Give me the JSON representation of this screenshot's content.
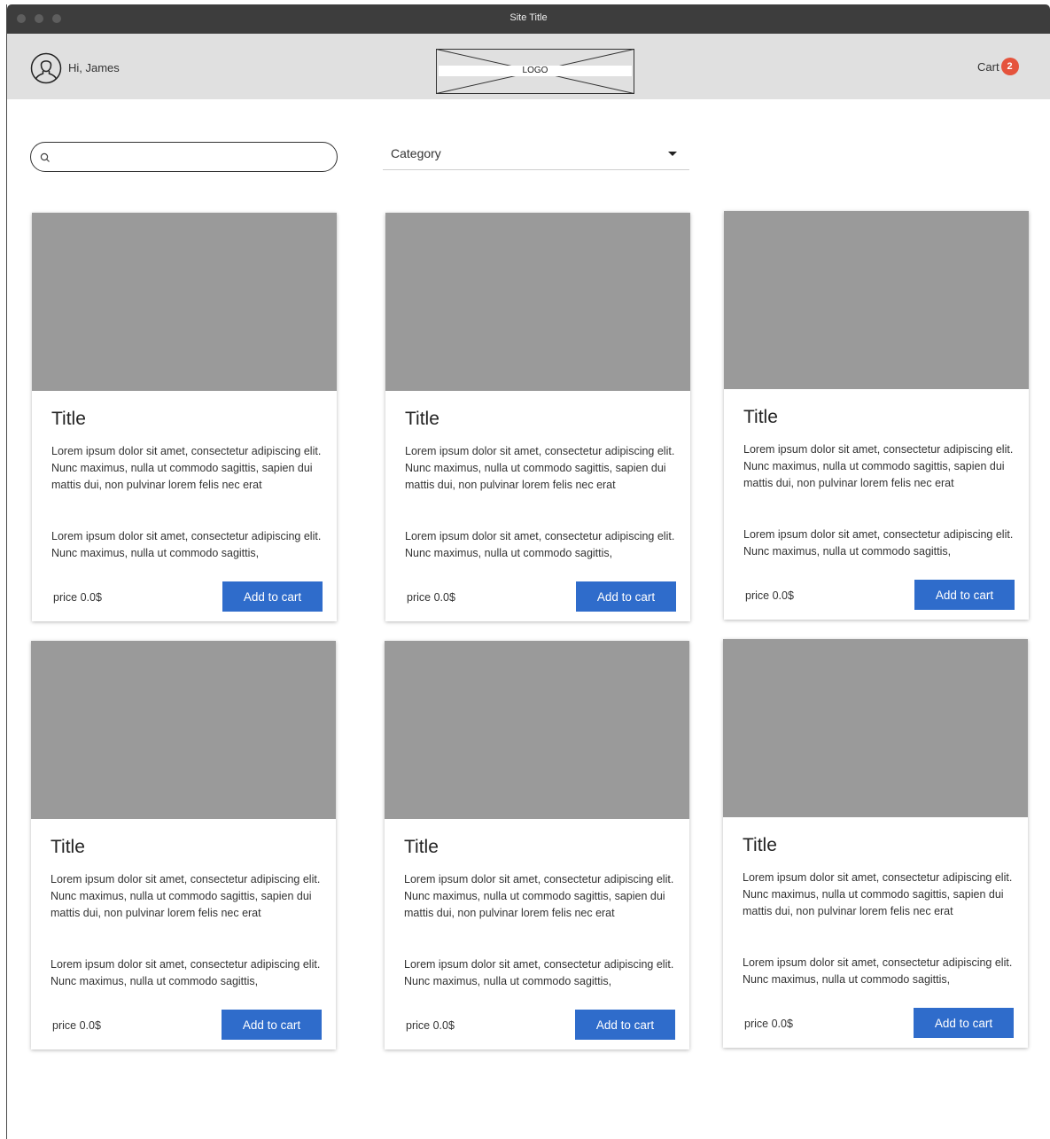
{
  "window": {
    "title": "Site Title"
  },
  "header": {
    "greeting": "Hi, James",
    "logo_label": "LOGO",
    "cart_label": "Cart",
    "cart_count": "2"
  },
  "search": {
    "value": "",
    "placeholder": ""
  },
  "filter": {
    "category_label": "Category"
  },
  "products": [
    {
      "title": "Title",
      "description": "Lorem ipsum dolor sit amet, consectetur adipiscing elit. Nunc maximus, nulla ut commodo sagittis, sapien dui mattis dui, non pulvinar lorem felis nec erat",
      "description2": "Lorem ipsum dolor sit amet, consectetur adipiscing elit. Nunc maximus, nulla ut commodo sagittis,",
      "price": "price 0.0$",
      "button_label": "Add to cart"
    },
    {
      "title": "Title",
      "description": "Lorem ipsum dolor sit amet, consectetur adipiscing elit. Nunc maximus, nulla ut commodo sagittis, sapien dui mattis dui, non pulvinar lorem felis nec erat",
      "description2": "Lorem ipsum dolor sit amet, consectetur adipiscing elit. Nunc maximus, nulla ut commodo sagittis,",
      "price": "price 0.0$",
      "button_label": "Add to cart"
    },
    {
      "title": "Title",
      "description": "Lorem ipsum dolor sit amet, consectetur adipiscing elit. Nunc maximus, nulla ut commodo sagittis, sapien dui mattis dui, non pulvinar lorem felis nec erat",
      "description2": "Lorem ipsum dolor sit amet, consectetur adipiscing elit. Nunc maximus, nulla ut commodo sagittis,",
      "price": "price 0.0$",
      "button_label": "Add to cart"
    },
    {
      "title": "Title",
      "description": "Lorem ipsum dolor sit amet, consectetur adipiscing elit. Nunc maximus, nulla ut commodo sagittis, sapien dui mattis dui, non pulvinar lorem felis nec erat",
      "description2": "Lorem ipsum dolor sit amet, consectetur adipiscing elit. Nunc maximus, nulla ut commodo sagittis,",
      "price": "price 0.0$",
      "button_label": "Add to cart"
    },
    {
      "title": "Title",
      "description": "Lorem ipsum dolor sit amet, consectetur adipiscing elit. Nunc maximus, nulla ut commodo sagittis, sapien dui mattis dui, non pulvinar lorem felis nec erat",
      "description2": "Lorem ipsum dolor sit amet, consectetur adipiscing elit. Nunc maximus, nulla ut commodo sagittis,",
      "price": "price 0.0$",
      "button_label": "Add to cart"
    },
    {
      "title": "Title",
      "description": "Lorem ipsum dolor sit amet, consectetur adipiscing elit. Nunc maximus, nulla ut commodo sagittis, sapien dui mattis dui, non pulvinar lorem felis nec erat",
      "description2": "Lorem ipsum dolor sit amet, consectetur adipiscing elit. Nunc maximus, nulla ut commodo sagittis,",
      "price": "price 0.0$",
      "button_label": "Add to cart"
    }
  ],
  "icons": {
    "avatar": "user-avatar-icon",
    "search": "search-icon",
    "category_dropdown": "chevron-down-icon"
  },
  "colors": {
    "titlebar": "#3d3d3d",
    "header_bg": "#e0e0e0",
    "image_placeholder": "#9a9a9a",
    "button": "#2f6ccb",
    "cart_badge": "#e5533c"
  }
}
